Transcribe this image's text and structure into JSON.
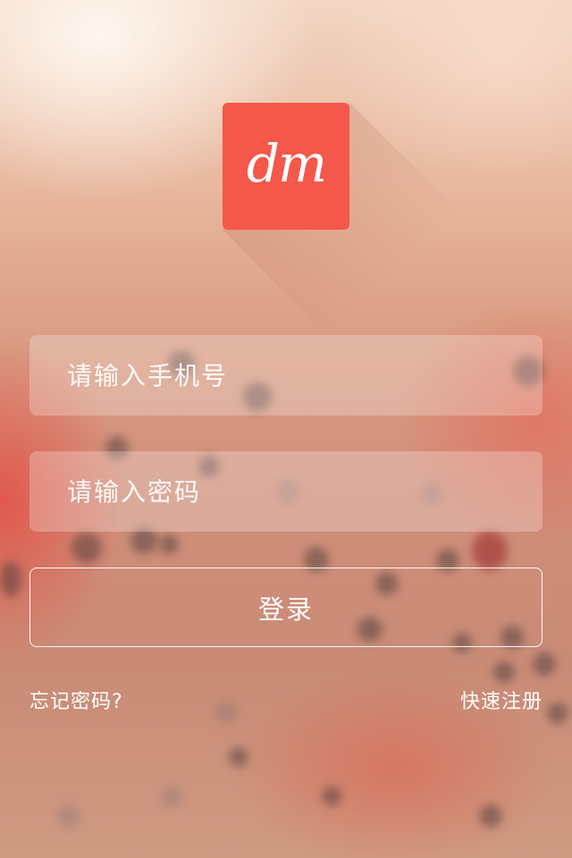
{
  "logo": {
    "text": "dm",
    "color": "#f5574a"
  },
  "form": {
    "phone_placeholder": "请输入手机号",
    "password_placeholder": "请输入密码",
    "login_label": "登录"
  },
  "links": {
    "forgot": "忘记密码?",
    "register": "快速注册"
  }
}
